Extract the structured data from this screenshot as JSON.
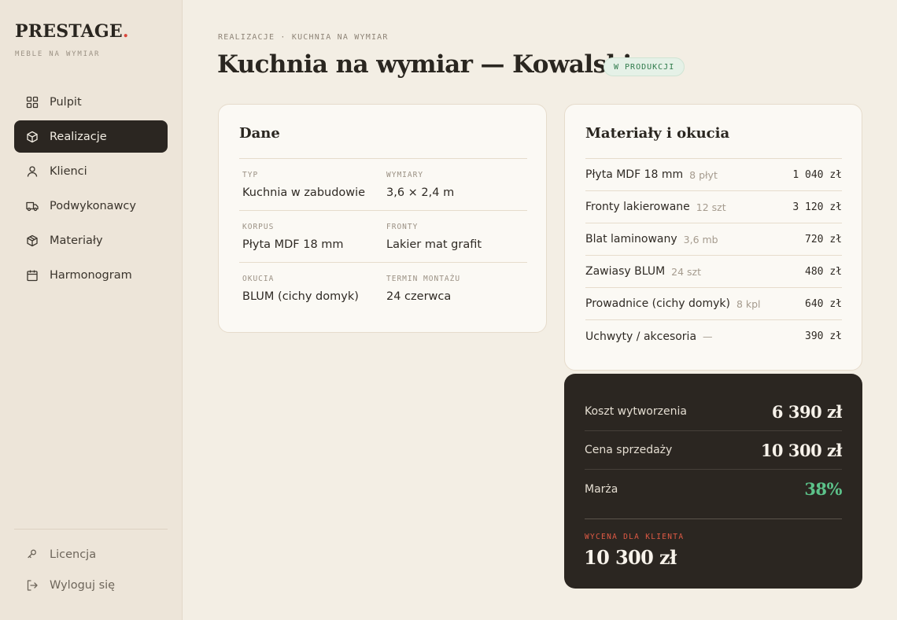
{
  "brand": {
    "name": "PRESTAGE",
    "dot": ".",
    "tagline": "MEBLE NA WYMIAR",
    "accent": "#d9453a"
  },
  "nav": [
    {
      "label": "Pulpit",
      "icon": "grid-icon",
      "active": false
    },
    {
      "label": "Realizacje",
      "icon": "cube-icon",
      "active": true
    },
    {
      "label": "Klienci",
      "icon": "user-icon",
      "active": false
    },
    {
      "label": "Podwykonawcy",
      "icon": "truck-icon",
      "active": false
    },
    {
      "label": "Materiały",
      "icon": "box-icon",
      "active": false
    },
    {
      "label": "Harmonogram",
      "icon": "calendar-icon",
      "active": false
    }
  ],
  "sidebar_bottom": [
    {
      "label": "Licencja",
      "icon": "key-icon"
    },
    {
      "label": "Wyloguj się",
      "icon": "logout-icon"
    }
  ],
  "header": {
    "breadcrumb": "REALIZACJE · KUCHNIA NA WYMIAR",
    "title": "Kuchnia na wymiar — Kowalski",
    "status": "W PRODUKCJI"
  },
  "dane": {
    "title": "Dane",
    "rows": [
      [
        {
          "label": "TYP",
          "value": "Kuchnia w zabudowie"
        },
        {
          "label": "WYMIARY",
          "value": "3,6 × 2,4 m"
        }
      ],
      [
        {
          "label": "KORPUS",
          "value": "Płyta MDF 18 mm"
        },
        {
          "label": "FRONTY",
          "value": "Lakier mat grafit"
        }
      ],
      [
        {
          "label": "OKUCIA",
          "value": "BLUM (cichy domyk)"
        },
        {
          "label": "TERMIN MONTAŻU",
          "value": "24 czerwca"
        }
      ]
    ]
  },
  "materials": {
    "title": "Materiały i okucia",
    "items": [
      {
        "name": "Płyta MDF 18 mm",
        "qty": "8 płyt",
        "price": "1 040 zł"
      },
      {
        "name": "Fronty lakierowane",
        "qty": "12 szt",
        "price": "3 120 zł"
      },
      {
        "name": "Blat laminowany",
        "qty": "3,6 mb",
        "price": "720 zł"
      },
      {
        "name": "Zawiasy BLUM",
        "qty": "24 szt",
        "price": "480 zł"
      },
      {
        "name": "Prowadnice (cichy domyk)",
        "qty": "8 kpl",
        "price": "640 zł"
      },
      {
        "name": "Uchwyty / akcesoria",
        "qty": "—",
        "price": "390 zł"
      }
    ]
  },
  "summary": {
    "cost_label": "Koszt wytworzenia",
    "cost_value": "6 390 zł",
    "price_label": "Cena sprzedaży",
    "price_value": "10 300 zł",
    "margin_label": "Marża",
    "margin_value": "38%",
    "quote_label": "WYCENA DLA KLIENTA",
    "quote_value": "10 300 zł"
  }
}
